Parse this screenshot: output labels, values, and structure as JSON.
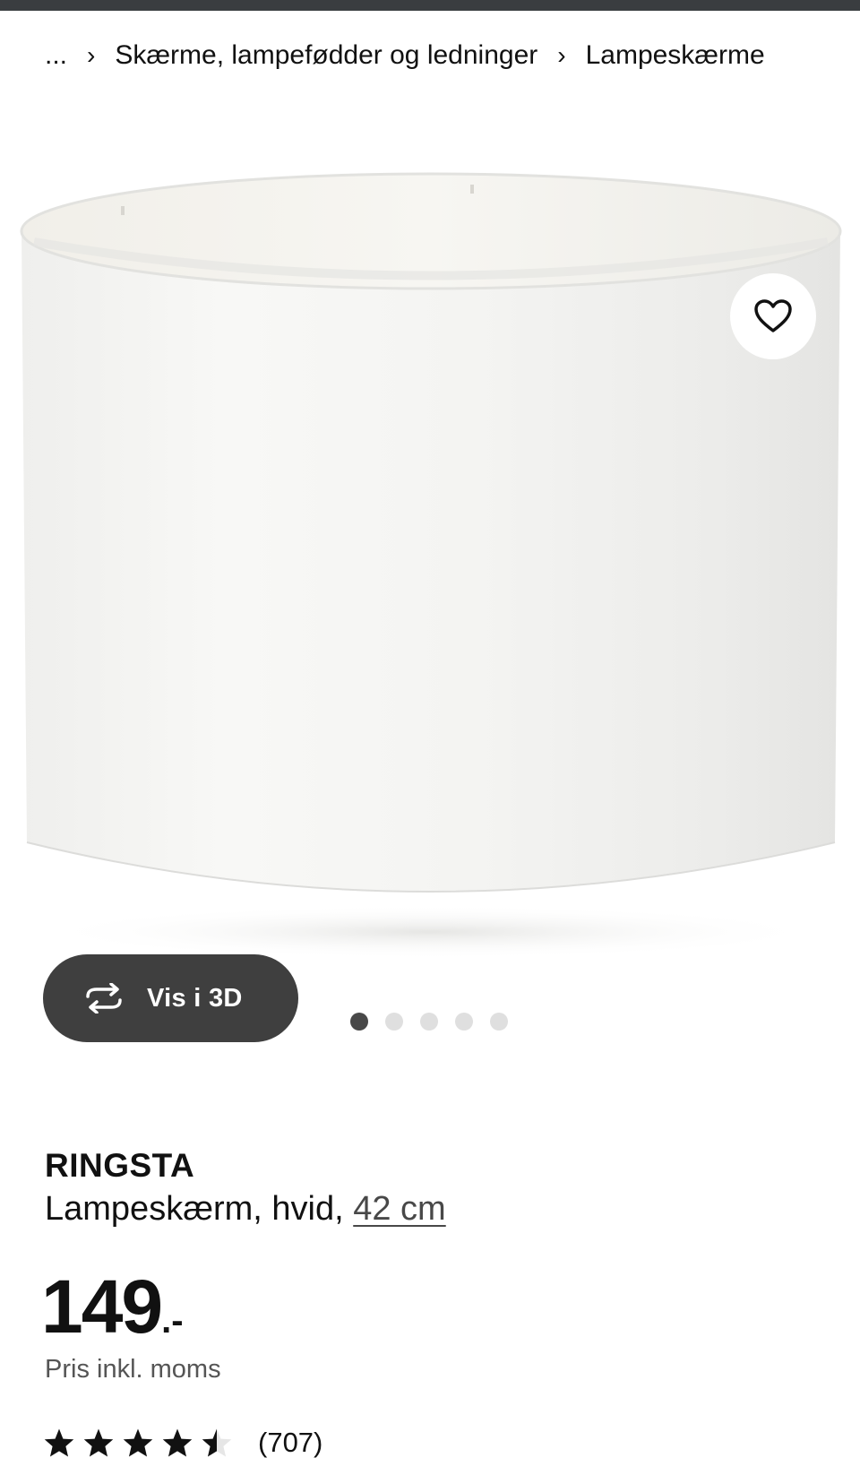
{
  "breadcrumb": {
    "ellipsis": "...",
    "separator": "›",
    "items": [
      {
        "label": "Skærme, lampefødder og ledninger"
      },
      {
        "label": "Lampeskærme"
      }
    ]
  },
  "media": {
    "image_subject": "white drum lampshade",
    "favorite_icon": "heart-outline-icon",
    "view3d": {
      "icon": "rotate-3d-icon",
      "label": "Vis i 3D"
    },
    "carousel": {
      "count": 5,
      "active_index": 0
    }
  },
  "product": {
    "name": "RINGSTA",
    "description_prefix": "Lampeskærm, hvid, ",
    "size_link": "42 cm",
    "price": {
      "amount": "149",
      "suffix": ".-"
    },
    "price_note": "Pris inkl. moms",
    "rating": {
      "value": 4.5,
      "max": 5,
      "count_label": "(707)"
    }
  },
  "colors": {
    "topbar": "#3a3d40",
    "pill": "#3f3f3f",
    "dot_active": "#484848",
    "dot_inactive": "#dfdfdf",
    "text": "#111111",
    "muted": "#555555"
  }
}
